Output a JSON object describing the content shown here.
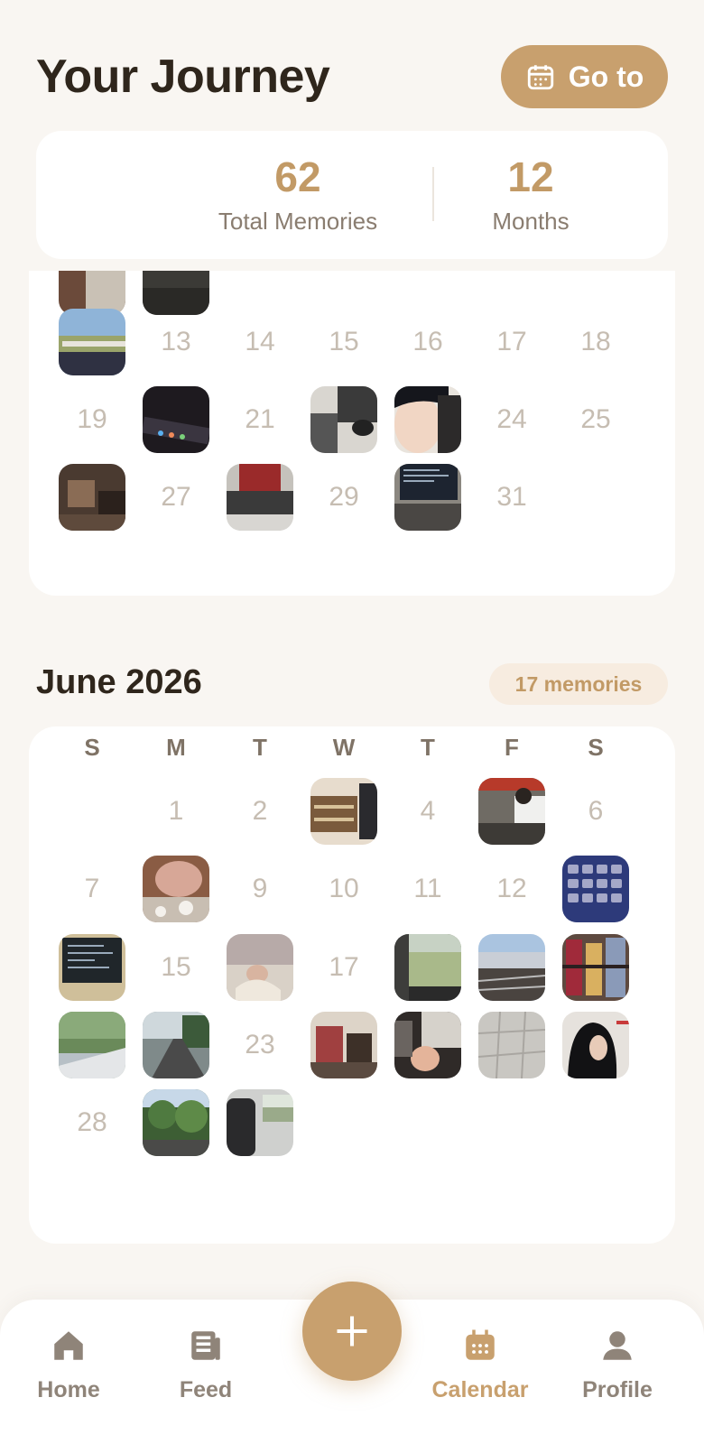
{
  "header": {
    "title": "Your Journey",
    "goto_label": "Go to"
  },
  "stats": {
    "total": "62",
    "total_label": "Total Memories",
    "months": "12",
    "months_label": "Months"
  },
  "may": {
    "numbers": [
      "13",
      "14",
      "15",
      "16",
      "17",
      "18",
      "19",
      "21",
      "24",
      "25",
      "27",
      "29",
      "31"
    ]
  },
  "june": {
    "title": "June 2026",
    "memories_badge": "17 memories",
    "weekdays": [
      "S",
      "M",
      "T",
      "W",
      "T",
      "F",
      "S"
    ],
    "numbers": [
      "1",
      "2",
      "4",
      "6",
      "7",
      "9",
      "10",
      "11",
      "12",
      "15",
      "17",
      "23",
      "28"
    ]
  },
  "nav": {
    "home": "Home",
    "feed": "Feed",
    "calendar": "Calendar",
    "profile": "Profile"
  },
  "colors": {
    "accent": "#c8a06e",
    "background": "#f9f6f2"
  },
  "icons": [
    "calendar-icon",
    "home-icon",
    "feed-icon",
    "plus-icon",
    "profile-icon"
  ]
}
